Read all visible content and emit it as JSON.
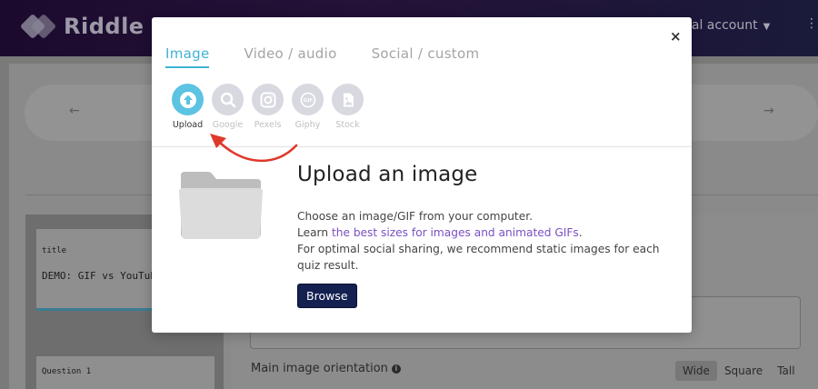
{
  "app": {
    "brand": "Riddle",
    "account_label": "nal account",
    "kebab": "⋮"
  },
  "editor": {
    "prev_arrow": "←",
    "next_arrow": "→",
    "cards": [
      {
        "label": "title",
        "value": "DEMO: GIF vs YouTube"
      },
      {
        "label": "Question 1"
      }
    ],
    "orientation_label": "Main image orientation",
    "orientation_options": [
      "Wide",
      "Square",
      "Tall"
    ],
    "orientation_selected": "Wide"
  },
  "modal": {
    "close": "×",
    "tabs": [
      "Image",
      "Video / audio",
      "Social / custom"
    ],
    "active_tab": "Image",
    "sources": [
      {
        "label": "Upload",
        "icon": "upload-arrow-icon"
      },
      {
        "label": "Google",
        "icon": "magnifier-icon"
      },
      {
        "label": "Pexels",
        "icon": "camera-icon"
      },
      {
        "label": "Giphy",
        "icon": "gif-icon"
      },
      {
        "label": "Stock",
        "icon": "image-file-icon"
      }
    ],
    "active_source": "Upload",
    "upload": {
      "title": "Upload an image",
      "line1": "Choose an image/GIF from your computer.",
      "line2_prefix": "Learn ",
      "line2_link": "the best sizes for images and animated GIFs",
      "line2_suffix": ".",
      "line3": "For optimal social sharing, we recommend static images for each quiz result.",
      "browse_label": "Browse"
    }
  },
  "colors": {
    "accent": "#3fb3d2",
    "upload_circle": "#5cc3e3",
    "link": "#7a4fc4",
    "browse_bg": "#142050",
    "annotation_arrow": "#e0392a"
  }
}
